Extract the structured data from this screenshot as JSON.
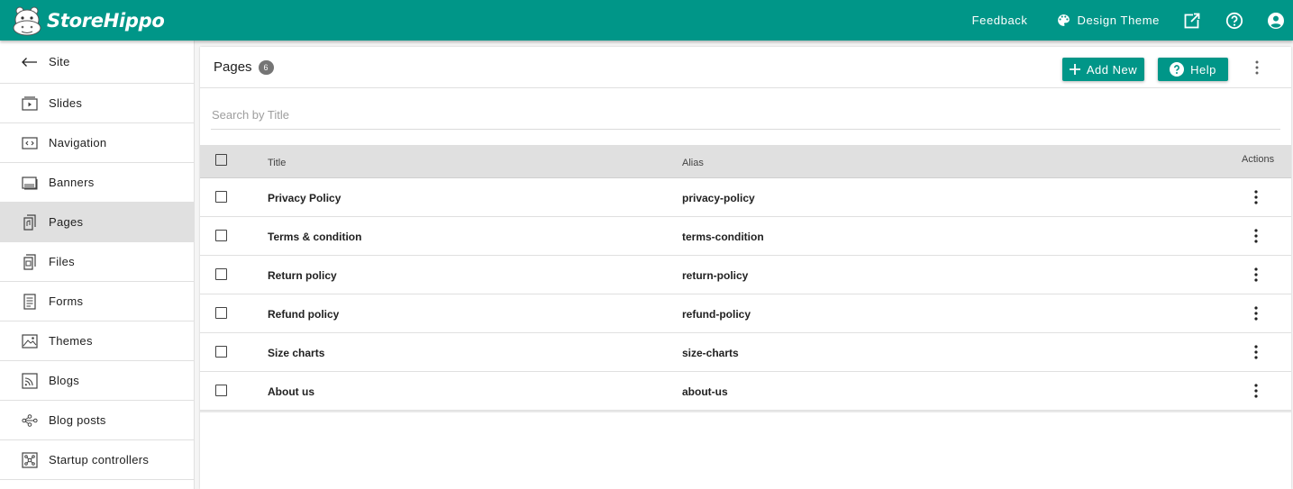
{
  "app": {
    "brand": "StoreHippo",
    "colors": {
      "primary": "#009688",
      "active_row": "#e0e0e0",
      "badge": "#757575"
    }
  },
  "topbar": {
    "feedback": "Feedback",
    "design_theme": "Design Theme",
    "icons": [
      "palette-icon",
      "open-external-icon",
      "help-circle-icon",
      "account-icon"
    ]
  },
  "sidebar": {
    "back_label": "Site",
    "items": [
      {
        "label": "Slides",
        "icon": "slides-icon",
        "active": false
      },
      {
        "label": "Navigation",
        "icon": "navigation-icon",
        "active": false
      },
      {
        "label": "Banners",
        "icon": "banners-icon",
        "active": false
      },
      {
        "label": "Pages",
        "icon": "pages-icon",
        "active": true
      },
      {
        "label": "Files",
        "icon": "files-icon",
        "active": false
      },
      {
        "label": "Forms",
        "icon": "forms-icon",
        "active": false
      },
      {
        "label": "Themes",
        "icon": "themes-icon",
        "active": false
      },
      {
        "label": "Blogs",
        "icon": "blogs-icon",
        "active": false
      },
      {
        "label": "Blog posts",
        "icon": "blog-posts-icon",
        "active": false
      },
      {
        "label": "Startup controllers",
        "icon": "startup-controllers-icon",
        "active": false
      }
    ]
  },
  "main": {
    "title": "Pages",
    "count": "6",
    "add_new": "Add New",
    "help": "Help",
    "search_placeholder": "Search by Title",
    "table": {
      "headers": {
        "title": "Title",
        "alias": "Alias",
        "actions": "Actions"
      },
      "rows": [
        {
          "title": "Privacy Policy",
          "alias": "privacy-policy"
        },
        {
          "title": "Terms & condition",
          "alias": "terms-condition"
        },
        {
          "title": "Return policy",
          "alias": "return-policy"
        },
        {
          "title": "Refund policy",
          "alias": "refund-policy"
        },
        {
          "title": "Size charts",
          "alias": "size-charts"
        },
        {
          "title": "About us",
          "alias": "about-us"
        }
      ]
    }
  }
}
